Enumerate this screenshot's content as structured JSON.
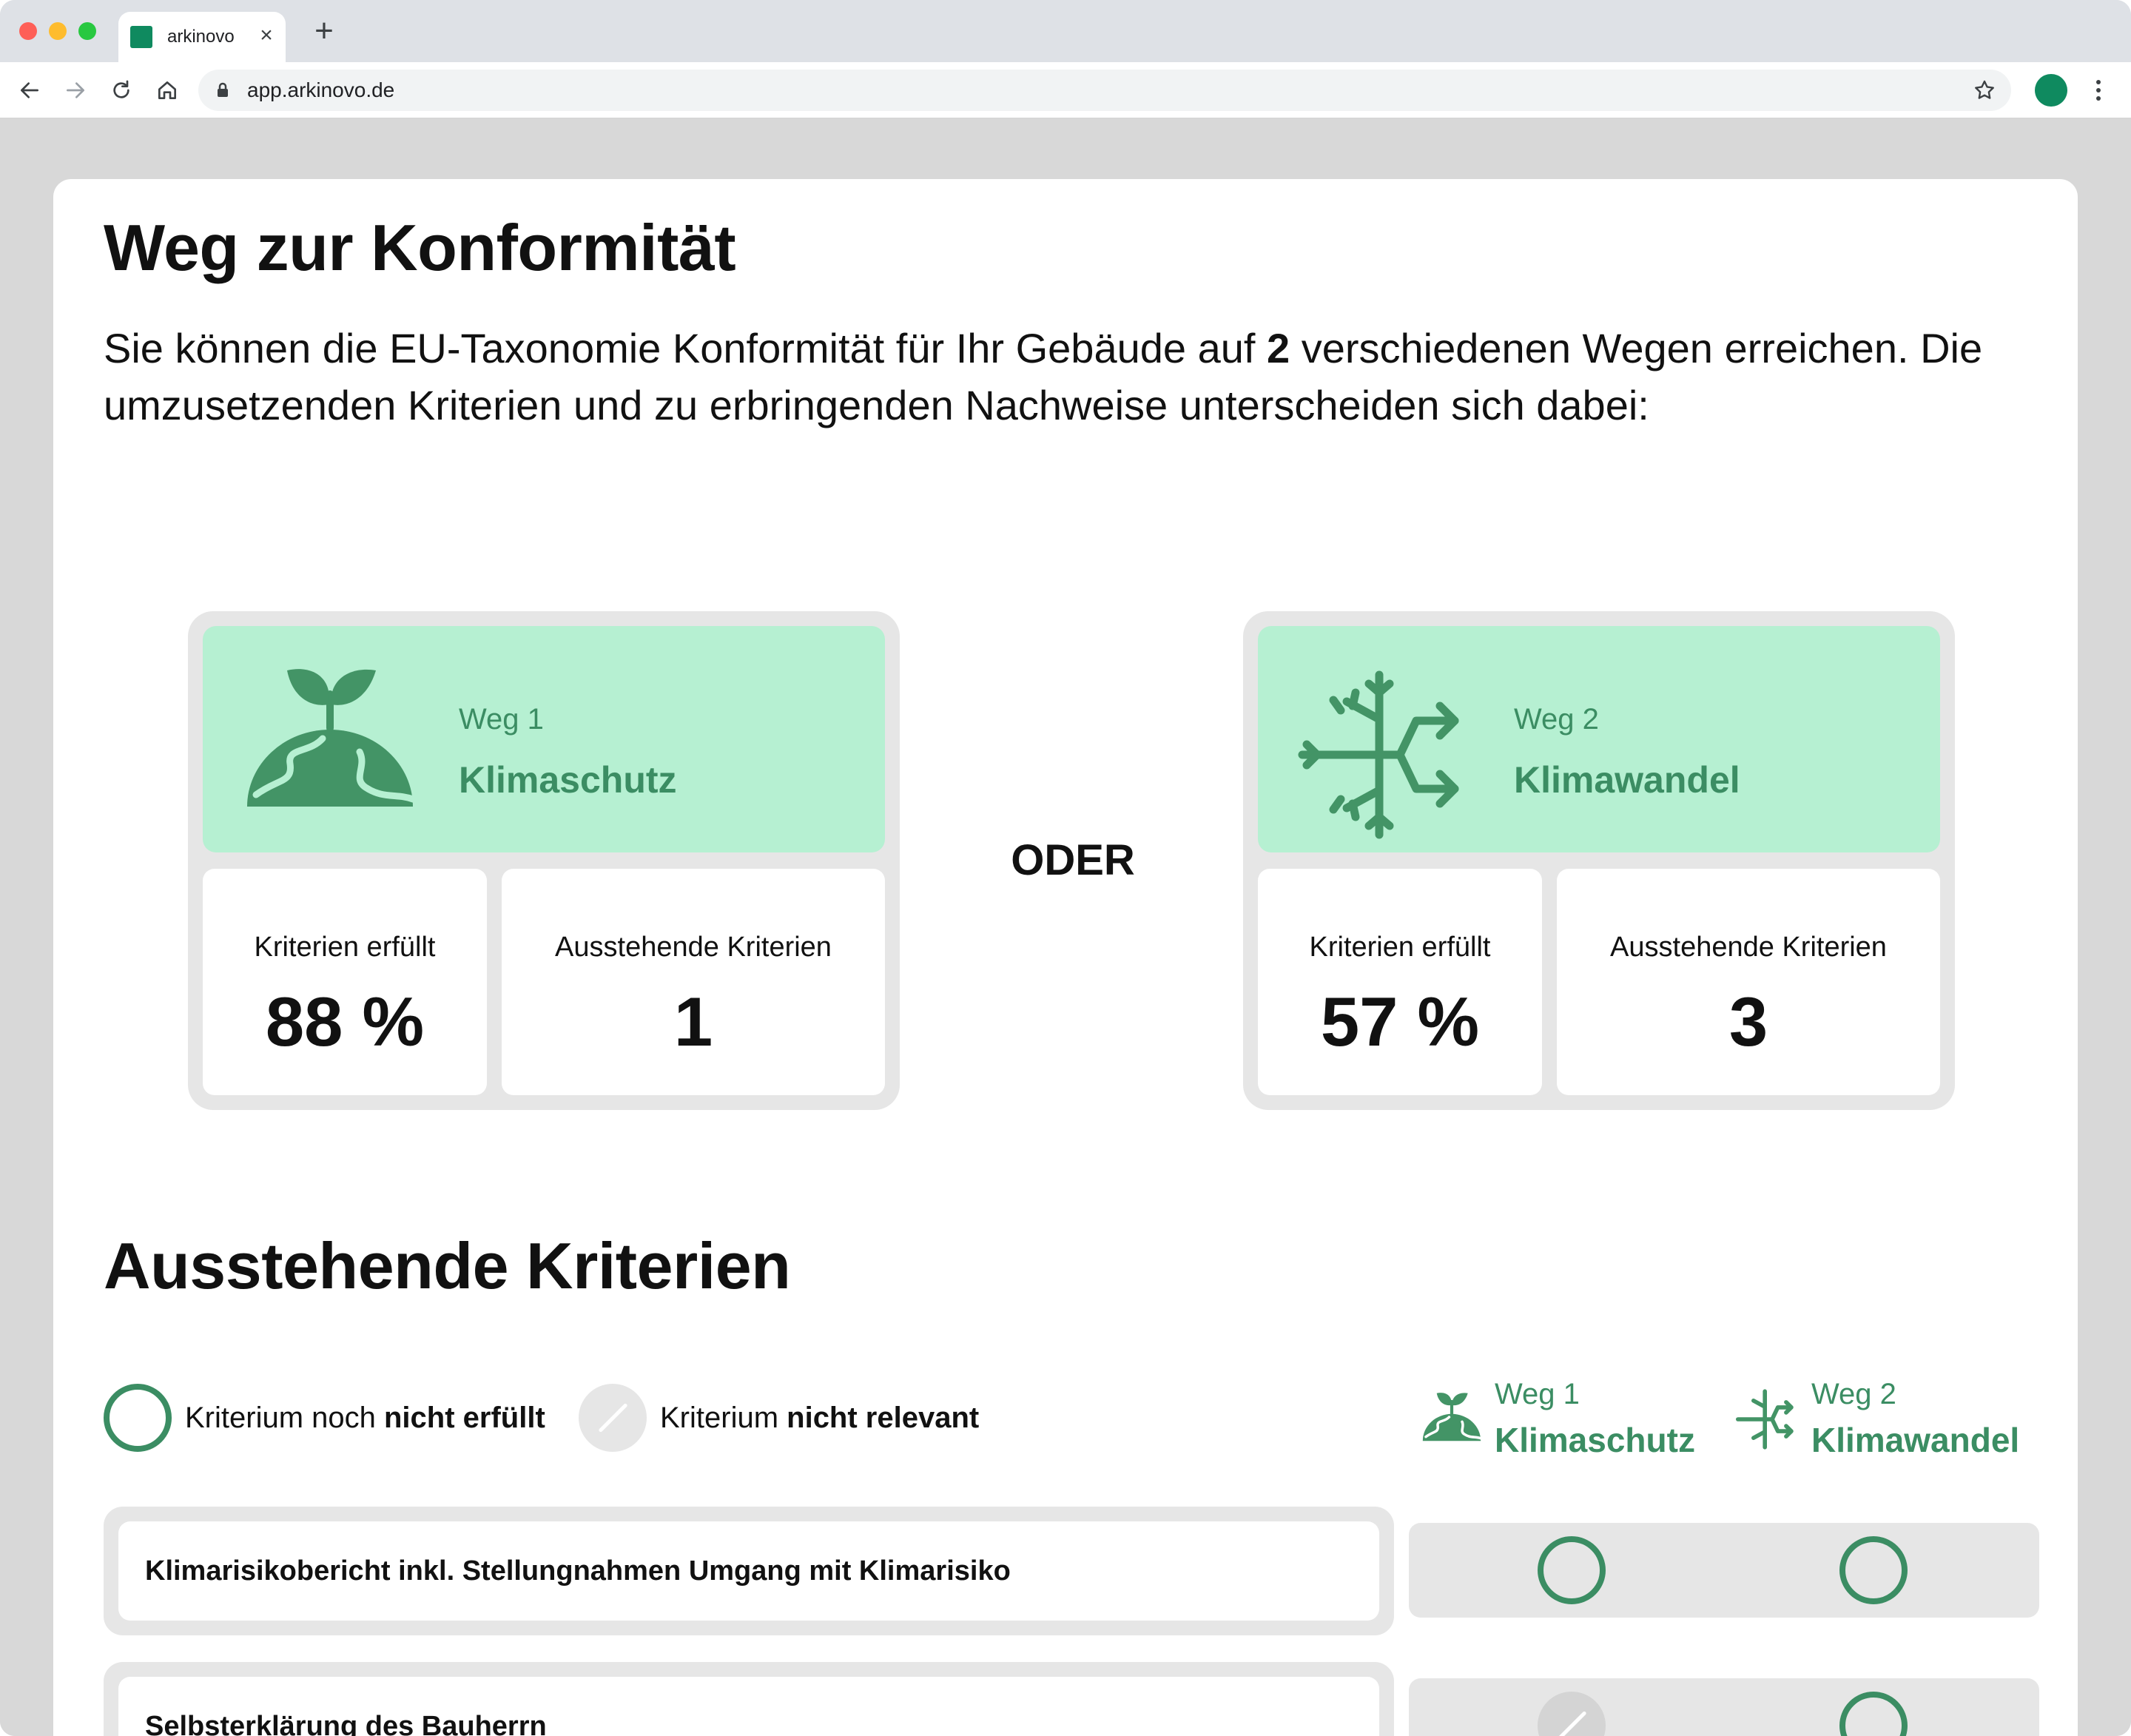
{
  "browser": {
    "tab_title": "arkinovo",
    "tab_close": "×",
    "new_tab": "+",
    "url": "app.arkinovo.de"
  },
  "page": {
    "title": "Weg zur Konformität",
    "intro_before": "Sie können die EU-Taxonomie Konformität für Ihr Gebäude auf ",
    "intro_count": "2",
    "intro_after": " verschiedenen Wegen erreichen. Die umzusetzenden Kriterien und zu erbringenden Nachweise unterscheiden sich dabei:",
    "separator": "ODER",
    "pending_title": "Ausstehende Kriterien"
  },
  "paths": [
    {
      "kicker": "Weg 1",
      "name": "Klimaschutz",
      "icon": "plant-globe-icon",
      "fulfilled_label": "Kriterien erfüllt",
      "fulfilled_value": "88 %",
      "pending_label": "Ausstehende Kriterien",
      "pending_value": "1"
    },
    {
      "kicker": "Weg 2",
      "name": "Klimawandel",
      "icon": "snowflake-arrows-icon",
      "fulfilled_label": "Kriterien erfüllt",
      "fulfilled_value": "57 %",
      "pending_label": "Ausstehende Kriterien",
      "pending_value": "3"
    }
  ],
  "legend": {
    "not_met_prefix": "Kriterium noch ",
    "not_met_bold": "nicht erfüllt",
    "not_relevant_prefix": "Kriterium ",
    "not_relevant_bold": "nicht relevant"
  },
  "criteria": [
    {
      "label": "Klimarisikobericht inkl. Stellungnahmen Umgang mit Klimarisiko",
      "weg1": "not-met",
      "weg2": "not-met"
    },
    {
      "label": "Selbsterklärung des Bauherrn",
      "weg1": "not-relevant",
      "weg2": "not-met"
    }
  ],
  "colors": {
    "accent_green": "#3b8d63",
    "header_green": "#b6f0d2",
    "brand_green": "#0f8a5f",
    "panel_gray": "#e6e6e6",
    "backdrop_gray": "#d8d8d8"
  }
}
